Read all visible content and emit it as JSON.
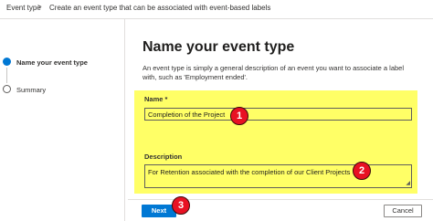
{
  "breadcrumb": {
    "root": "Event type",
    "separator": ">",
    "current": "Create an event type that can be associated with event-based labels"
  },
  "steps": [
    {
      "label": "Name your event type",
      "active": true
    },
    {
      "label": "Summary",
      "active": false
    }
  ],
  "main": {
    "title": "Name your event type",
    "description": "An event type is simply a general description of an event you want to associate a label with, such as 'Employment ended'.",
    "name_label": "Name *",
    "name_value": "Completion of the Project",
    "description_label": "Description",
    "description_value": "For Retention associated with the completion of our Client Projects"
  },
  "callouts": [
    "1",
    "2",
    "3"
  ],
  "footer": {
    "next_label": "Next",
    "cancel_label": "Cancel"
  },
  "colors": {
    "accent": "#0078d4",
    "highlight": "#ffff66",
    "callout": "#e81123"
  }
}
